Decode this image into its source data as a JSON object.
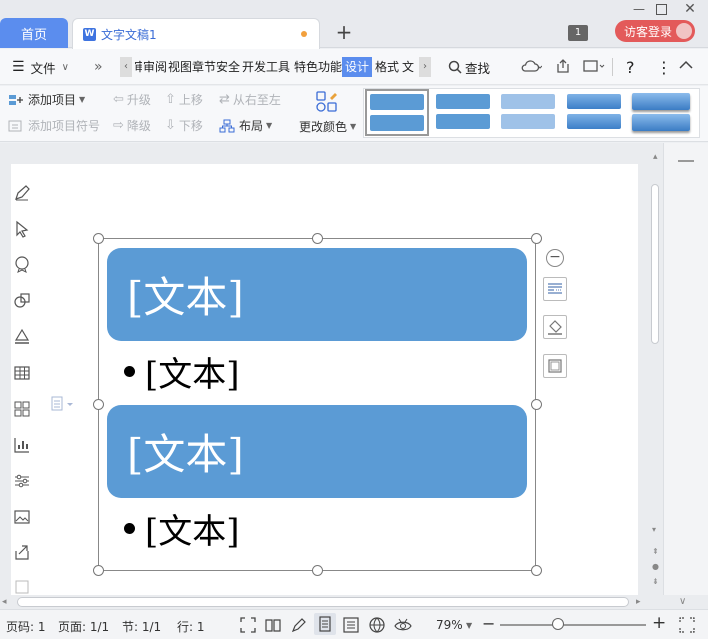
{
  "titlebar": {
    "home_tab": "首页",
    "doc_tab": "文字文稿1",
    "doc_icon": "W",
    "badge": "1",
    "login": "访客登录"
  },
  "menubar": {
    "file": "文件",
    "tabs": [
      "审阅",
      "视图",
      "章节",
      "安全",
      "开发工具",
      "特色功能",
      "设计",
      "格式",
      "文"
    ],
    "selected_tab": "设计",
    "search": "查找"
  },
  "ribbon": {
    "add_item": "添加项目",
    "add_bullet": "添加项目符号",
    "promote": "升级",
    "demote": "降级",
    "move_up": "上移",
    "move_down": "下移",
    "rtl": "从右至左",
    "layout": "布局",
    "change_color": "更改颜色"
  },
  "smartart": {
    "box1": "[文本]",
    "bullet1": "[文本]",
    "box2": "[文本]",
    "bullet2": "[文本]"
  },
  "statusbar": {
    "page_num": "页码: 1",
    "pages": "页面: 1/1",
    "section": "节: 1/1",
    "row": "行: 1",
    "zoom": "79%"
  },
  "colors": {
    "accent": "#5b8dee",
    "shape": "#5b9bd5",
    "login": "#e35a5a"
  }
}
